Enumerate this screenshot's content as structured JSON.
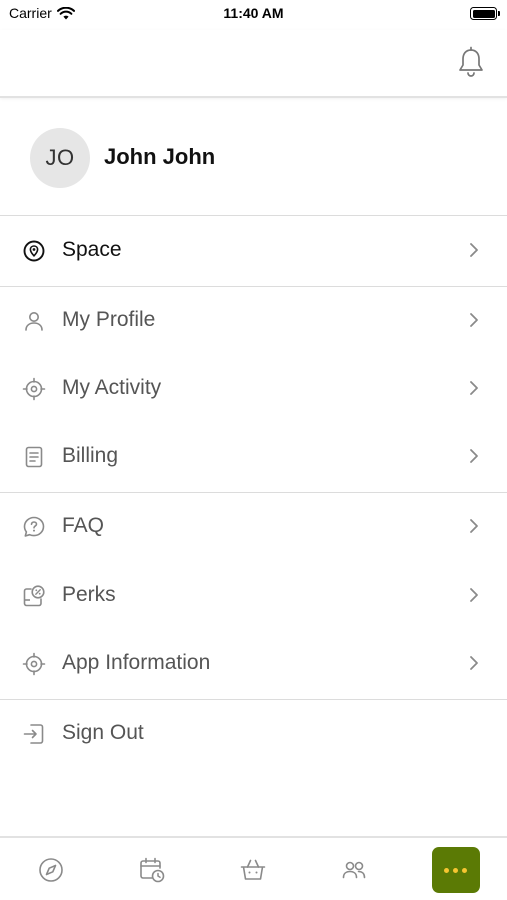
{
  "status_bar": {
    "carrier": "Carrier",
    "time": "11:40 AM"
  },
  "header": {
    "notification_icon": "bell-icon"
  },
  "profile": {
    "initials": "JO",
    "name": "John John"
  },
  "menu": {
    "space": {
      "label": "Space",
      "icon": "location-pin-icon"
    },
    "my_profile": {
      "label": "My Profile",
      "icon": "user-icon"
    },
    "my_activity": {
      "label": "My Activity",
      "icon": "crosshair-icon"
    },
    "billing": {
      "label": "Billing",
      "icon": "document-icon"
    },
    "faq": {
      "label": "FAQ",
      "icon": "question-bubble-icon"
    },
    "perks": {
      "label": "Perks",
      "icon": "discount-tag-icon"
    },
    "app_information": {
      "label": "App Information",
      "icon": "crosshair-icon"
    },
    "sign_out": {
      "label": "Sign Out",
      "icon": "sign-out-icon"
    }
  },
  "tab_bar": {
    "tabs": [
      {
        "icon": "compass-icon",
        "active": false
      },
      {
        "icon": "calendar-clock-icon",
        "active": false
      },
      {
        "icon": "basket-icon",
        "active": false
      },
      {
        "icon": "people-icon",
        "active": false
      },
      {
        "icon": "more-dots-icon",
        "active": true
      }
    ]
  },
  "colors": {
    "accent": "#5b7a05",
    "accent_dots": "#f6c531",
    "icon_gray": "#8a8a8a",
    "divider": "#dcdcdc"
  }
}
